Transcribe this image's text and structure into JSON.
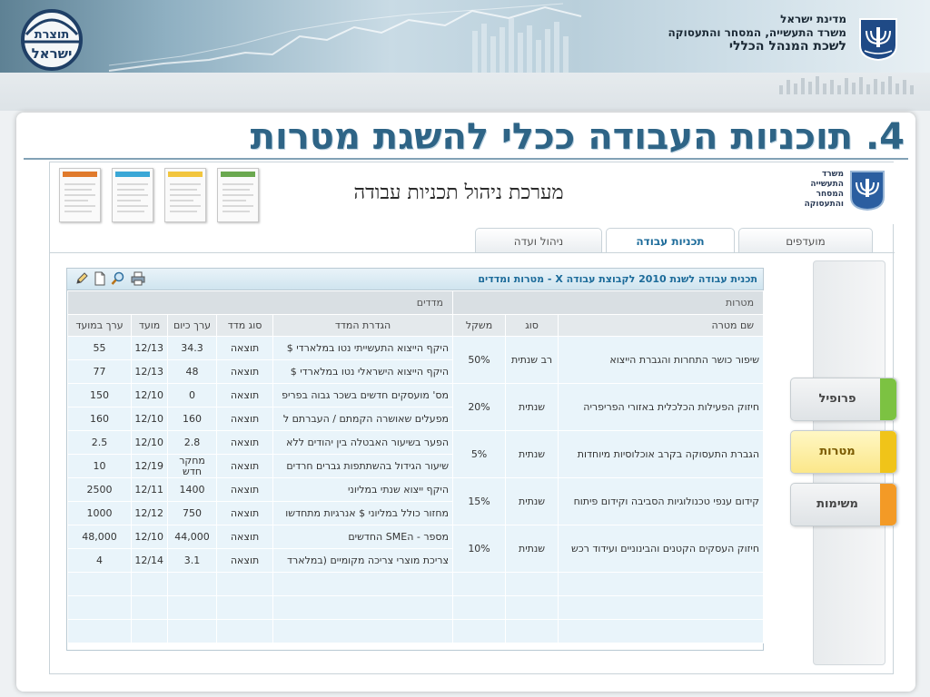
{
  "banner": {
    "ministry_line1": "מדינת ישראל",
    "ministry_line2": "משרד התעשייה, המסחר והתעסוקה",
    "ministry_line3": "לשכת המנהל הכללי"
  },
  "slide": {
    "title": "4. תוכניות העבודה ככלי להשגת מטרות"
  },
  "app": {
    "ministry": [
      "משרד",
      "התעשייה",
      "המסחר",
      "והתעסוקה"
    ],
    "title": "מערכת ניהול תכניות עבודה",
    "tabs": [
      {
        "label": "מועדפים",
        "active": false
      },
      {
        "label": "תכניות עבודה",
        "active": true
      },
      {
        "label": "ניהול ועדה",
        "active": false
      }
    ],
    "side_buttons": [
      {
        "label": "פרופיל",
        "accent": "#7cc242",
        "active": false
      },
      {
        "label": "מטרות",
        "accent": "#f0c419",
        "active": true
      },
      {
        "label": "משימות",
        "accent": "#f39a26",
        "active": false
      }
    ],
    "doc_colors": [
      "#e07a2c",
      "#3aa7d6",
      "#f2c53d",
      "#6aa84f"
    ],
    "panel_title": "תכנית עבודה לשנת 2010 לקבוצת עבודה X - מטרות ומדדים",
    "table": {
      "group_goals": "מטרות",
      "group_measures": "מדדים",
      "columns": [
        "שם מטרה",
        "סוג",
        "משקל",
        "הגדרת המדד",
        "סוג מדד",
        "ערך כיום",
        "מועד",
        "ערך במועד"
      ],
      "goals": [
        {
          "name": "שיפור כושר התחרות והגברת הייצוא",
          "type": "רב שנתית",
          "weight": "50%",
          "measures": [
            {
              "def": "היקף הייצוא התעשייתי נטו במלארדי $",
              "mtype": "תוצאה",
              "current": "34.3",
              "date": "12/13",
              "target": "55"
            },
            {
              "def": "היקף הייצוא הישראלי נטו במלארדי $",
              "mtype": "תוצאה",
              "current": "48",
              "date": "12/13",
              "target": "77"
            }
          ]
        },
        {
          "name": "חיזוק הפעילות הכלכלית באזורי הפריפריה",
          "type": "שנתית",
          "weight": "20%",
          "measures": [
            {
              "def": "מס' מועסקים חדשים בשכר גבוה בפריפ",
              "mtype": "תוצאה",
              "current": "0",
              "date": "12/10",
              "target": "150"
            },
            {
              "def": "מפעלים שאושרה הקמתם / העברתם ל",
              "mtype": "תוצאה",
              "current": "160",
              "date": "12/10",
              "target": "160"
            }
          ]
        },
        {
          "name": "הגברת התעסוקה בקרב אוכלוסיות מיוחדות",
          "type": "שנתית",
          "weight": "5%",
          "measures": [
            {
              "def": "הפער בשיעור האבטלה בין יהודים ללא",
              "mtype": "תוצאה",
              "current": "2.8",
              "date": "12/10",
              "target": "2.5"
            },
            {
              "def": "שיעור הגידול בהשתתפות גברים חרדים",
              "mtype": "תוצאה",
              "current": "מחקר חדש",
              "date": "12/19",
              "target": "10"
            }
          ]
        },
        {
          "name": "קידום ענפי טכנולוגיות הסביבה וקידום פיתוח",
          "type": "שנתית",
          "weight": "15%",
          "measures": [
            {
              "def": "היקף ייצוא שנתי במליוני",
              "mtype": "תוצאה",
              "current": "1400",
              "date": "12/11",
              "target": "2500"
            },
            {
              "def": "מחזור כולל במליוני $ אנרגיות מתחדשו",
              "mtype": "תוצאה",
              "current": "750",
              "date": "12/12",
              "target": "1000"
            }
          ]
        },
        {
          "name": "חיזוק העסקים הקטנים והבינוניים ועידוד רכש",
          "type": "שנתית",
          "weight": "10%",
          "measures": [
            {
              "def": "מספר - הSME החדשים",
              "mtype": "תוצאה",
              "current": "44,000",
              "date": "12/10",
              "target": "48,000"
            },
            {
              "def": "צריכת מוצרי צריכה מקומיים (במלארד",
              "mtype": "תוצאה",
              "current": "3.1",
              "date": "12/14",
              "target": "4"
            }
          ]
        }
      ]
    }
  }
}
